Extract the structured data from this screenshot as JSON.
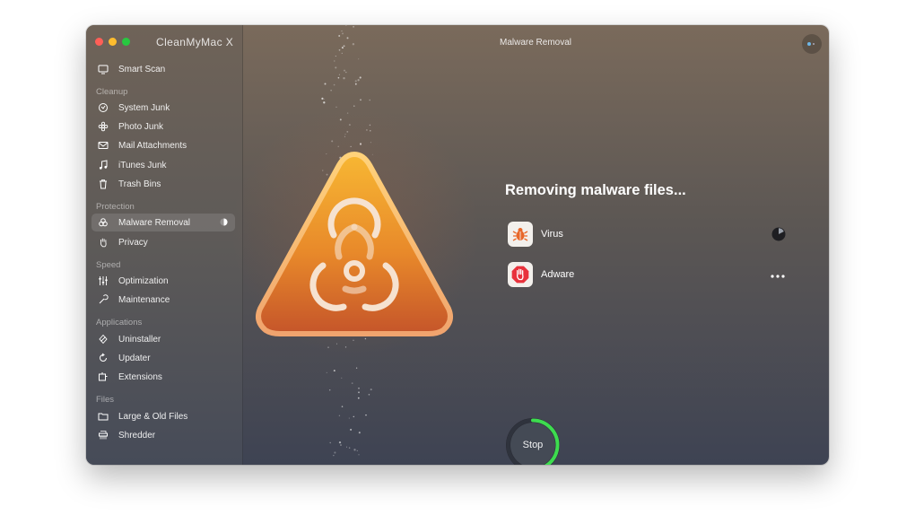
{
  "app": {
    "name": "CleanMyMac X",
    "window_title": "Malware Removal"
  },
  "sidebar": {
    "top_item": "Smart Scan",
    "sections": [
      {
        "label": "Cleanup",
        "items": [
          "System Junk",
          "Photo Junk",
          "Mail Attachments",
          "iTunes Junk",
          "Trash Bins"
        ]
      },
      {
        "label": "Protection",
        "items": [
          "Malware Removal",
          "Privacy"
        ]
      },
      {
        "label": "Speed",
        "items": [
          "Optimization",
          "Maintenance"
        ]
      },
      {
        "label": "Applications",
        "items": [
          "Uninstaller",
          "Updater",
          "Extensions"
        ]
      },
      {
        "label": "Files",
        "items": [
          "Large & Old Files",
          "Shredder"
        ]
      }
    ],
    "active_item": "Malware Removal"
  },
  "main": {
    "status_title": "Removing malware files...",
    "threats": [
      {
        "label": "Virus",
        "icon": "bug-icon",
        "status": "in-progress"
      },
      {
        "label": "Adware",
        "icon": "stop-hand-icon",
        "status": "pending"
      }
    ],
    "stop_button": {
      "label": "Stop",
      "progress": 0.42
    }
  },
  "colors": {
    "accent_green": "#3ddc4f",
    "hero_orange": "#e8892a",
    "adware_red": "#e8323c"
  }
}
